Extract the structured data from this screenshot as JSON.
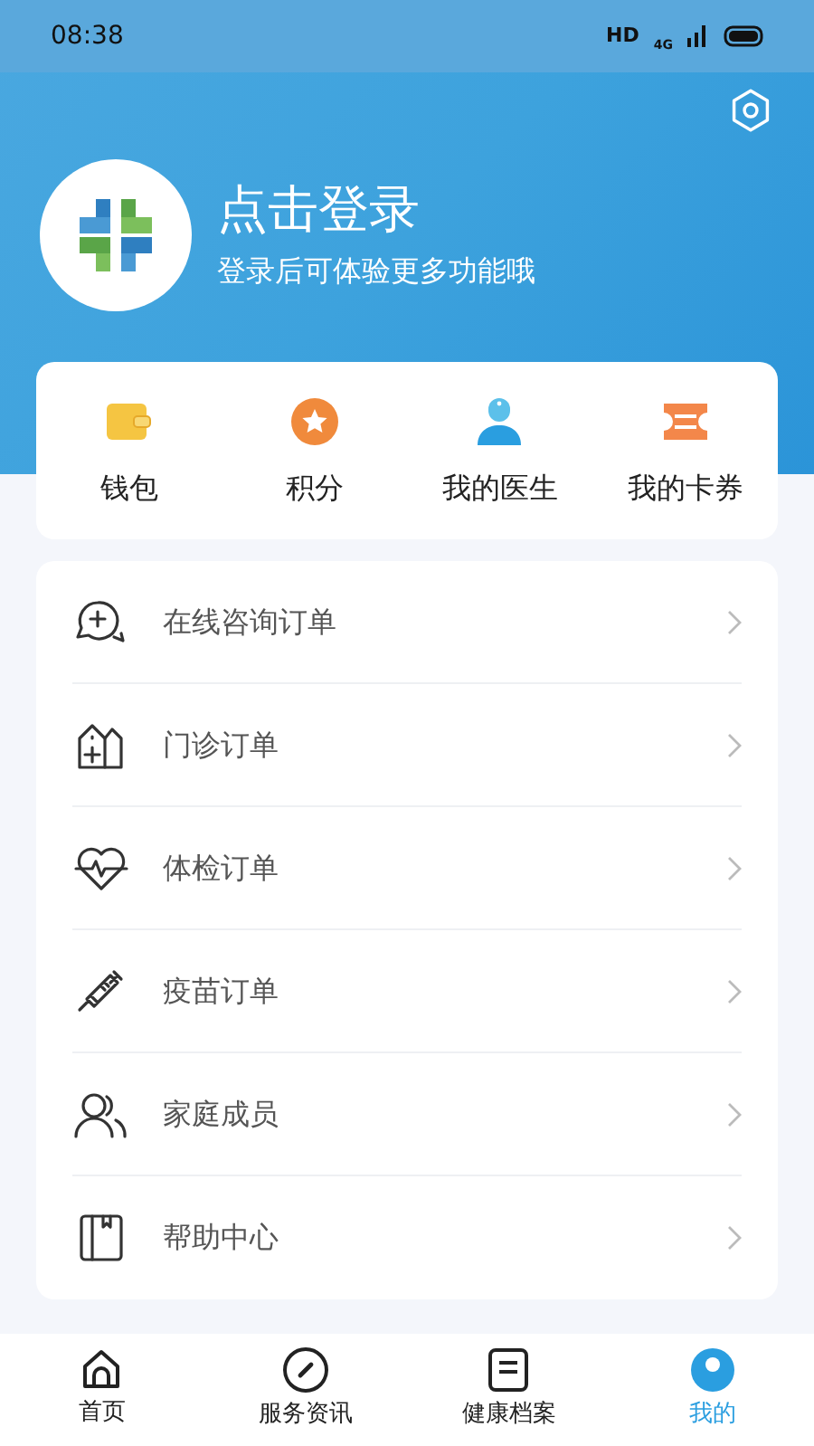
{
  "status_bar": {
    "time": "08:38",
    "hd": "HD",
    "network": "4G"
  },
  "profile": {
    "title": "点击登录",
    "subtitle": "登录后可体验更多功能哦"
  },
  "shortcuts": [
    {
      "kind": "wallet",
      "label": "钱包"
    },
    {
      "kind": "points",
      "label": "积分"
    },
    {
      "kind": "doctor",
      "label": "我的医生"
    },
    {
      "kind": "coupon",
      "label": "我的卡券"
    }
  ],
  "menu": [
    {
      "kind": "consult",
      "label": "在线咨询订单"
    },
    {
      "kind": "clinic",
      "label": "门诊订单"
    },
    {
      "kind": "checkup",
      "label": "体检订单"
    },
    {
      "kind": "vaccine",
      "label": "疫苗订单"
    },
    {
      "kind": "family",
      "label": "家庭成员"
    },
    {
      "kind": "help",
      "label": "帮助中心"
    }
  ],
  "tabs": [
    {
      "kind": "home",
      "label": "首页",
      "selected": false
    },
    {
      "kind": "service",
      "label": "服务资讯",
      "selected": false
    },
    {
      "kind": "record",
      "label": "健康档案",
      "selected": false
    },
    {
      "kind": "me",
      "label": "我的",
      "selected": true
    }
  ]
}
